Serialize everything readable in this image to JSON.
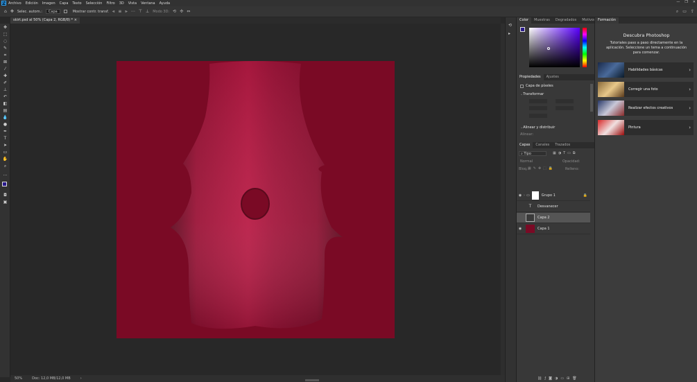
{
  "menubar": {
    "logo": "Ps",
    "items": [
      "Archivo",
      "Edición",
      "Imagen",
      "Capa",
      "Texto",
      "Selección",
      "Filtro",
      "3D",
      "Vista",
      "Ventana",
      "Ayuda"
    ],
    "window_controls": [
      "—",
      "❐",
      "✕"
    ]
  },
  "options": {
    "auto_select_label": "Selec. autom.:",
    "auto_select_value": "Capa",
    "show_transform_label": "Mostrar contr. transf.",
    "mode_3d_label": "Modo 3D:"
  },
  "document": {
    "tab_title": "skirt.psd al 50% (Capa 2, RGB/8) *",
    "canvas_color": "#7a0a25"
  },
  "status": {
    "zoom": "50%",
    "doc_size": "Doc: 12,0 MB/12,0 MB"
  },
  "color_panel": {
    "tabs": [
      "Color",
      "Muestras",
      "Degradados",
      "Motivos"
    ],
    "hue_color": "#2a1a8c"
  },
  "properties_panel": {
    "tabs": [
      "Propiedades",
      "Ajustes"
    ],
    "layer_type": "Capa de píxeles",
    "transform_label": "Transformar",
    "align_label": "Alinear y distribuir",
    "align_sub": "Alinear:"
  },
  "layers_panel": {
    "tabs": [
      "Capas",
      "Canales",
      "Trazados"
    ],
    "filter_label": "Tipo",
    "blend_mode": "Normal",
    "opacity_label": "Opacidad:",
    "lock_label": "Bloq.:",
    "fill_label": "Relleno:",
    "layers": [
      {
        "name": "Grupo 1",
        "visible": true,
        "kind": "group",
        "selected": false
      },
      {
        "name": "Desvanecer",
        "visible": false,
        "kind": "text",
        "selected": false
      },
      {
        "name": "Capa 2",
        "visible": false,
        "kind": "pixel",
        "selected": true
      },
      {
        "name": "Capa 1",
        "visible": true,
        "kind": "fill",
        "selected": false
      }
    ]
  },
  "learn_panel": {
    "tab": "Formación",
    "title": "Descubra Photoshop",
    "description": "Tutoriales paso a paso directamente en la aplicación. Seleccione un tema a continuación para comenzar.",
    "cards": [
      {
        "label": "Habilidades básicas"
      },
      {
        "label": "Corregir una foto"
      },
      {
        "label": "Realizar efectos creativos"
      },
      {
        "label": "Pintura"
      }
    ]
  }
}
